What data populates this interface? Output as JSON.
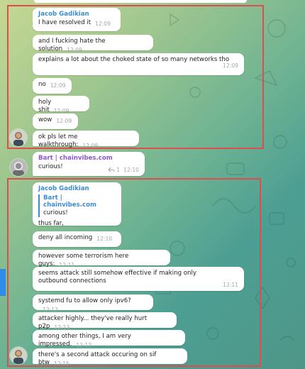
{
  "messages": [
    {
      "sender": "Jacob Gadikian",
      "text": "I have resolved it",
      "time": "12:09"
    },
    {
      "text": "and I fucking hate the solution",
      "time": "12:09"
    },
    {
      "text": "explains a lot about the choked state of so many networks tho",
      "time": "12:09"
    },
    {
      "text": "no",
      "time": "12:09"
    },
    {
      "text": "holy shit",
      "time": "12:09"
    },
    {
      "text": "wow",
      "time": "12:09"
    },
    {
      "text": "ok pls let me walkthrough:",
      "time": "12:09"
    },
    {
      "sender": "Bart | chainvibes.com",
      "text": "curious!",
      "reply_count": "1",
      "time": "12:10"
    },
    {
      "sender": "Jacob Gadikian",
      "reply_to": {
        "name": "Bart | chainvibes.com",
        "text": "curious!"
      },
      "text": "thus far,",
      "time": ""
    },
    {
      "text": "deny all incoming",
      "time": "12:10"
    },
    {
      "text": "however some terrorism here guys:",
      "time": "12:11"
    },
    {
      "text": "seems attack still somehow effective if making only outbound connections",
      "time": "12:11"
    },
    {
      "text": "systemd fu to allow only ipv6?",
      "time": "12:12"
    },
    {
      "text": "attacker highly... they've really hurt p2p",
      "time": "12:13"
    },
    {
      "text": "among other things, I am very impressed.",
      "time": "12:13"
    },
    {
      "text": "there's a second attack occuring on sif btw",
      "time": "12:15"
    }
  ],
  "colors": {
    "highlight_frame": "#df4e4e",
    "sender_blue": "#3a8dd3",
    "sender_purple": "#8e57cc",
    "timestamp": "#a0a7ad",
    "bubble": "#ffffff"
  },
  "icons": {
    "reply_count_icon": "reply-arrow-icon"
  }
}
